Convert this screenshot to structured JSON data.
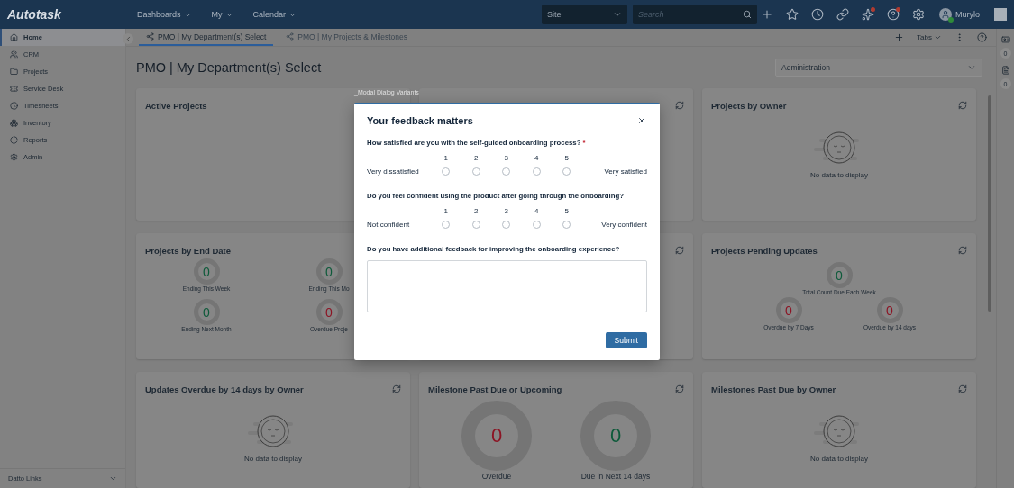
{
  "top_bar": {
    "logo": "Autotask",
    "nav": [
      {
        "label": "Dashboards"
      },
      {
        "label": "My"
      },
      {
        "label": "Calendar"
      }
    ],
    "site_select": {
      "value": "Site"
    },
    "search": {
      "placeholder": "Search"
    },
    "icons": [
      {
        "kind": "plus",
        "alert": false
      },
      {
        "kind": "star",
        "alert": false
      },
      {
        "kind": "clock",
        "alert": false
      },
      {
        "kind": "link",
        "alert": false
      },
      {
        "kind": "sparkle",
        "alert": true
      },
      {
        "kind": "help",
        "alert": true
      },
      {
        "kind": "gear",
        "alert": false
      }
    ],
    "user": {
      "name": "Murylo",
      "online": true
    }
  },
  "sidebar": {
    "items": [
      {
        "label": "Home",
        "kind": "home",
        "selected": true
      },
      {
        "label": "CRM",
        "kind": "users",
        "selected": false
      },
      {
        "label": "Projects",
        "kind": "folder",
        "selected": false
      },
      {
        "label": "Service Desk",
        "kind": "ticket",
        "selected": false
      },
      {
        "label": "Timesheets",
        "kind": "clock",
        "selected": false
      },
      {
        "label": "Inventory",
        "kind": "boxes",
        "selected": false
      },
      {
        "label": "Reports",
        "kind": "chart",
        "selected": false
      },
      {
        "label": "Admin",
        "kind": "gear",
        "selected": false
      }
    ],
    "footer": {
      "label": "Datto Links"
    }
  },
  "tabs": {
    "items": [
      {
        "label": "PMO | My Department(s) Select",
        "selected": true
      },
      {
        "label": "PMO | My Projects & Milestones",
        "selected": false
      }
    ],
    "menu_label": "Tabs"
  },
  "page": {
    "title": "PMO | My Department(s) Select",
    "department_select": {
      "value": "Administration"
    }
  },
  "widgets": [
    {
      "kind": "blank",
      "title": "Active Projects"
    },
    {
      "kind": "blank",
      "refresh": true
    },
    {
      "kind": "empty",
      "title": "Projects by Owner",
      "refresh": true,
      "message": "No data to display"
    },
    {
      "kind": "gauges",
      "title": "Projects by End Date",
      "gauges": [
        {
          "value": "0",
          "label": "Ending This Week",
          "color": "#0d5a3a"
        },
        {
          "value": "0",
          "label": "Ending This Mo",
          "color": "#0d5a3a"
        },
        {
          "value": "0",
          "label": "Ending Next Month",
          "color": "#0d5a3a"
        },
        {
          "value": "0",
          "label": "Overdue Proje",
          "color": "#8c1424"
        }
      ]
    },
    {
      "kind": "blank",
      "refresh": true
    },
    {
      "kind": "gauge_pyramid",
      "title": "Projects Pending Updates",
      "refresh": true,
      "gauges": [
        {
          "value": "0",
          "label": "Total Count Due Each Week",
          "color": "#0d5a3a"
        },
        {
          "value": "0",
          "label": "Overdue by 7 Days",
          "color": "#8c1424"
        },
        {
          "value": "0",
          "label": "Overdue by 14 days",
          "color": "#8c1424"
        }
      ]
    },
    {
      "kind": "empty",
      "title": "Updates Overdue by 14 days by Owner",
      "refresh": true,
      "message": "No data to display"
    },
    {
      "kind": "donuts",
      "title": "Milestone Past Due or Upcoming",
      "refresh": true,
      "gauges": [
        {
          "value": "0",
          "label": "Overdue",
          "color": "#8c1424"
        },
        {
          "value": "0",
          "label": "Due in Next 14 days",
          "color": "#0d5a3a"
        }
      ]
    },
    {
      "kind": "empty",
      "title": "Milestones Past Due by Owner",
      "refresh": true,
      "message": "No data to display"
    }
  ],
  "right_rail": {
    "badges": [
      "0",
      "0"
    ]
  },
  "modal": {
    "caption": "_Modal Dialog Variants",
    "title": "Your feedback matters",
    "questions": [
      {
        "kind": "scale",
        "text": "How satisfied are you with the self-guided onboarding process?",
        "required_mark": "*",
        "low": "Very dissatisfied",
        "high": "Very satisfied",
        "options": [
          {
            "label": "1",
            "selected": false
          },
          {
            "label": "2",
            "selected": false
          },
          {
            "label": "3",
            "selected": false
          },
          {
            "label": "4",
            "selected": false
          },
          {
            "label": "5",
            "selected": false
          }
        ]
      },
      {
        "kind": "scale",
        "text": "Do you feel confident using the product after going through the onboarding?",
        "low": "Not confident",
        "high": "Very confident",
        "options": [
          {
            "label": "1",
            "selected": false
          },
          {
            "label": "2",
            "selected": false
          },
          {
            "label": "3",
            "selected": false
          },
          {
            "label": "4",
            "selected": false
          },
          {
            "label": "5",
            "selected": false
          }
        ]
      },
      {
        "kind": "text",
        "text": "Do you have additional feedback for improving the onboarding experience?"
      }
    ],
    "submit": "Submit"
  }
}
